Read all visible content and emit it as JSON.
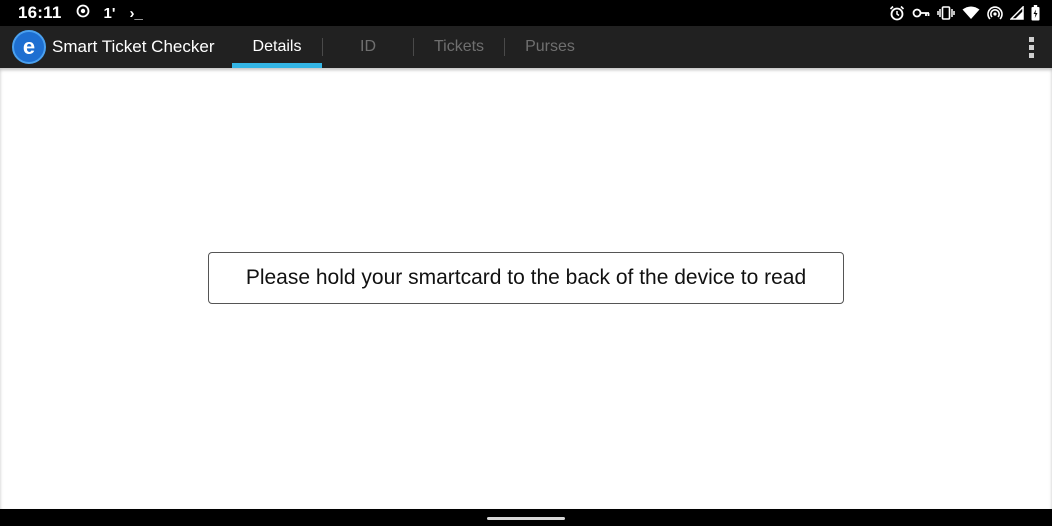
{
  "status_bar": {
    "time": "16:11",
    "left_icons": [
      "location-icon",
      "data-saver-icon",
      "terminal-icon"
    ],
    "data_saver_glyph": "1'",
    "terminal_glyph": "›_",
    "right_icons": [
      "alarm-icon",
      "vpn-key-icon",
      "vibrate-icon",
      "wifi-icon",
      "hotspot-icon",
      "cell-signal-icon",
      "battery-icon"
    ]
  },
  "app_bar": {
    "title": "Smart Ticket Checker",
    "logo_letter": "e",
    "tabs": [
      {
        "label": "Details",
        "active": true
      },
      {
        "label": "ID",
        "active": false
      },
      {
        "label": "Tickets",
        "active": false
      },
      {
        "label": "Purses",
        "active": false
      }
    ],
    "overflow_icon": "more-vert-icon"
  },
  "content": {
    "message": "Please hold your smartcard to the back of the device to read"
  },
  "colors": {
    "app_bar_bg": "#212121",
    "tab_indicator": "#33b5e5",
    "logo_blue": "#1e6fd1",
    "inactive_tab_text": "#6f6f6f"
  }
}
